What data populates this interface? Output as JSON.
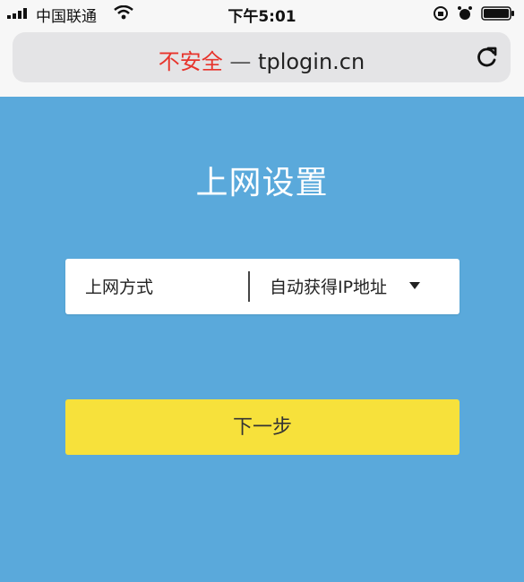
{
  "status_bar": {
    "carrier": "中国联通",
    "time": "下午5:01"
  },
  "address_bar": {
    "insecure_label": "不安全",
    "separator": " — ",
    "domain": "tplogin.cn"
  },
  "page": {
    "title": "上网设置",
    "connection_type_label": "上网方式",
    "connection_type_value": "自动获得IP地址",
    "next_button_label": "下一步"
  },
  "colors": {
    "background": "#5aa9db",
    "button": "#f7e13b",
    "insecure": "#e7342c"
  }
}
